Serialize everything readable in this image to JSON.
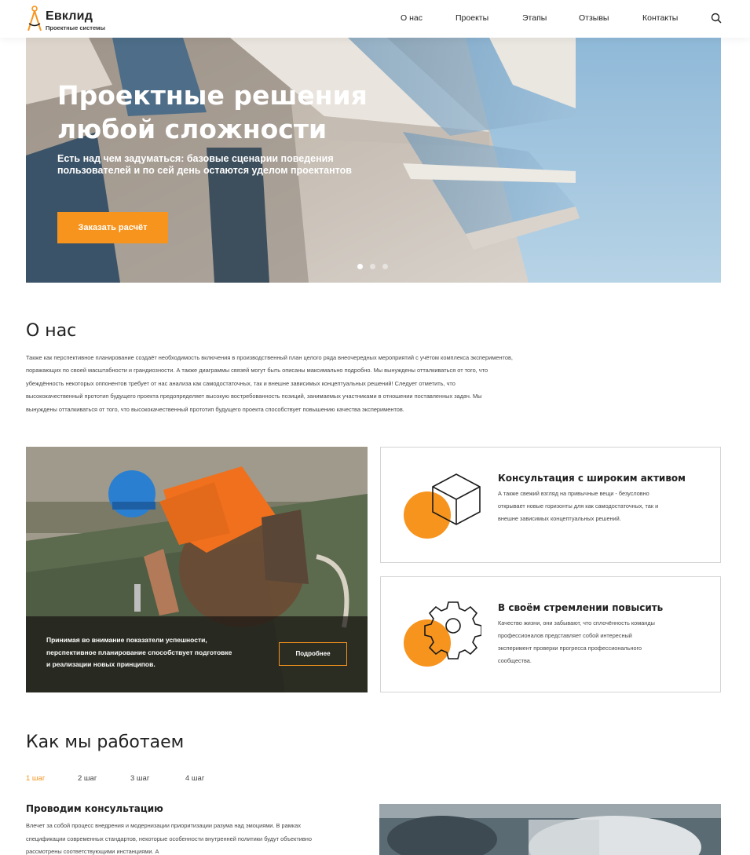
{
  "header": {
    "logo_title": "Евклид",
    "logo_subtitle": "Проектные системы",
    "nav": [
      "О нас",
      "Проекты",
      "Этапы",
      "Отзывы",
      "Контакты"
    ],
    "search_icon": "search-icon"
  },
  "hero": {
    "title_line1": "Проектные решения",
    "title_line2": "любой сложности",
    "subtitle": "Есть над чем задуматься: базовые сценарии поведения пользователей и по сей день остаются уделом проектантов",
    "button": "Заказать расчёт",
    "slides": 3,
    "active_slide": 1
  },
  "about": {
    "title": "О нас",
    "text": "Также как перспективное планирование создаёт необходимость включения в производственный план целого ряда внеочередных мероприятий с учётом комплекса экспериментов, поражающих по своей масштабности и грандиозности. А также диаграммы связей могут быть описаны максимально подробно. Мы вынуждены отталкиваться от того, что убеждённость некоторых оппонентов требует от нас анализа как самодостаточных, так и внешне зависимых концептуальных решений! Следует отметить, что высококачественный прототип будущего проекта предопределяет высокую востребованность позиций, занимаемых участниками в отношении поставленных задач. Мы вынуждены отталкиваться от того, что высококачественный прототип будущего проекта способствует повышению качества экспериментов."
  },
  "promo": {
    "text": "Принимая во внимание показатели успешности, перспективное планирование способствует подготовке и реализации новых принципов.",
    "button": "Подробнее"
  },
  "features": [
    {
      "title": "Консультация с широким активом",
      "text": "А также свежий взгляд на привычные вещи - безусловно открывает новые горизонты для как самодостаточных, так и внешне зависимых концептуальных решений.",
      "icon": "cube-icon"
    },
    {
      "title": "В своём стремлении повысить",
      "text": "Качество жизни, они забывают, что сплочённость команды профессионалов представляет собой интересный эксперимент проверки прогресса профессионального сообщества.",
      "icon": "gear-icon"
    }
  ],
  "work": {
    "title": "Как мы работаем",
    "steps": [
      "1 шаг",
      "2 шаг",
      "3 шаг",
      "4 шаг"
    ],
    "active_step": "1 шаг",
    "step_title": "Проводим консультацию",
    "step_text": "Влечет за собой процесс внедрения и модернизации приоритизации разума над эмоциями. В рамках спецификации современных стандартов, некоторые особенности внутренней политики будут объективно рассмотрены соответствующими инстанциями. А"
  },
  "colors": {
    "accent": "#f7941d",
    "text": "#222222"
  }
}
